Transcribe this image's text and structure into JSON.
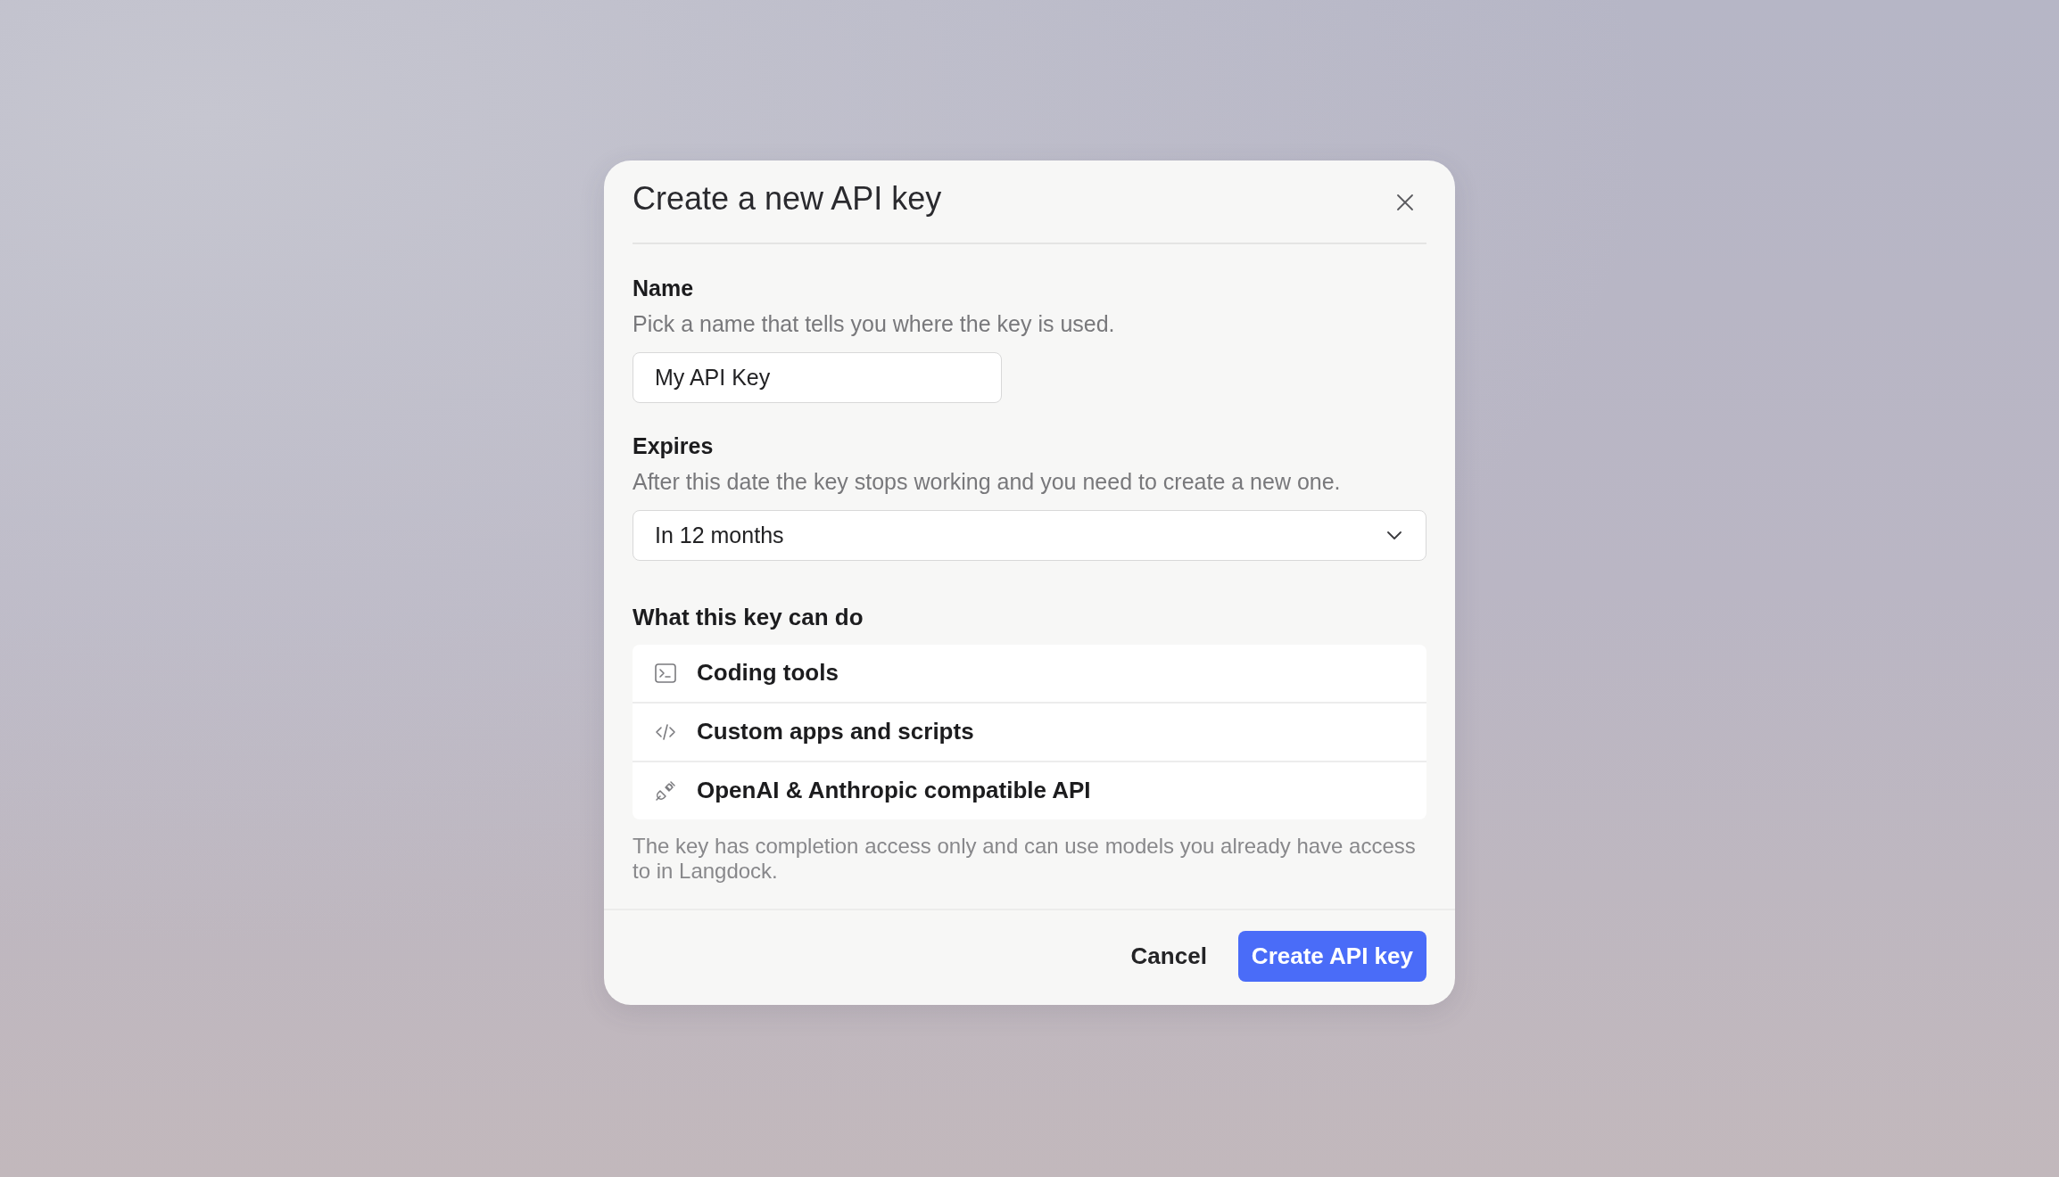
{
  "dialog": {
    "title": "Create a new API key",
    "fields": [
      {
        "kind": "text",
        "label": "Name",
        "description": "Pick a name that tells you where the key is used.",
        "value": "My API Key"
      },
      {
        "kind": "select",
        "label": "Expires",
        "description": "After this date the key stops working and you need to create a new one.",
        "value": "In 12 months"
      }
    ],
    "capabilities": {
      "heading": "What this key can do",
      "items": [
        {
          "kind": "terminal",
          "label": "Coding tools"
        },
        {
          "kind": "code",
          "label": "Custom apps and scripts"
        },
        {
          "kind": "plug",
          "label": "OpenAI & Anthropic compatible API"
        }
      ],
      "note": "The key has completion access only and can use models you already have access to in Langdock."
    },
    "buttons": [
      {
        "kind": "secondary",
        "label": "Cancel"
      },
      {
        "kind": "primary",
        "label": "Create API key"
      }
    ]
  }
}
